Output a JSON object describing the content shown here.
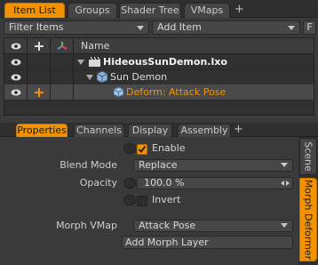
{
  "top_tabs": {
    "item_list": "Item List",
    "groups": "Groups",
    "shader_tree": "Shader Tree",
    "vmaps": "VMaps",
    "add": "+"
  },
  "toolbar": {
    "filter_items": "Filter Items",
    "add_item": "Add Item",
    "f_button": "F"
  },
  "list": {
    "header_name": "Name",
    "rows": [
      {
        "label": "HideousSunDemon.lxo",
        "icon": "clapperboard-icon"
      },
      {
        "label": "Sun Demon",
        "icon": "mesh-icon"
      },
      {
        "label": "Deform: Attack Pose",
        "icon": "morph-deformer-icon"
      }
    ]
  },
  "bottom_tabs": {
    "properties": "Properties",
    "channels": "Channels",
    "display": "Display",
    "assembly": "Assembly",
    "add": "+"
  },
  "side_tabs": {
    "scene": "Scene",
    "morph_deformer": "Morph Deformer"
  },
  "properties": {
    "enable_label": "Enable",
    "enable_checked": true,
    "blend_mode_label": "Blend Mode",
    "blend_mode_value": "Replace",
    "opacity_label": "Opacity",
    "opacity_value": "100.0 %",
    "invert_label": "Invert",
    "invert_checked": false,
    "morph_vmap_label": "Morph VMap",
    "morph_vmap_value": "Attack Pose",
    "add_morph_layer": "Add Morph Layer"
  },
  "colors": {
    "accent": "#f39200",
    "panel": "#3a3a3a",
    "selected_text": "#f39200"
  }
}
